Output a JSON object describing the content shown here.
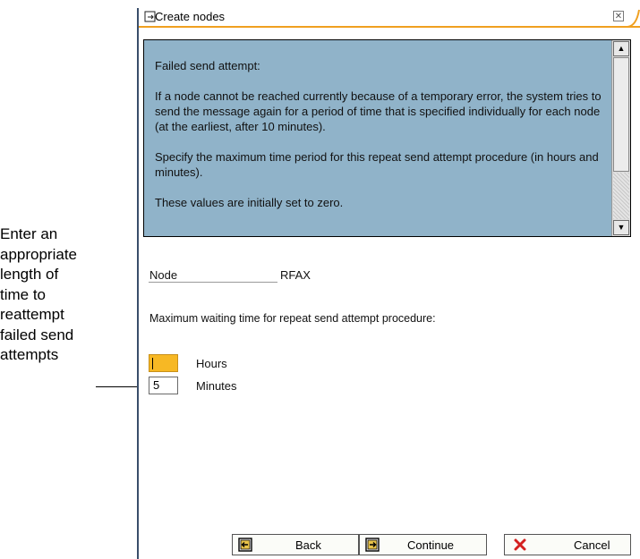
{
  "annotation": {
    "lines": [
      "Enter an",
      "appropriate",
      "length of",
      "time to",
      "reattempt",
      "failed send",
      "attempts"
    ]
  },
  "dialog": {
    "title": "Create nodes",
    "close_glyph": "✕",
    "help": {
      "paragraphs": [
        "Failed send attempt:",
        "If a node cannot be reached currently because of a temporary error, the system tries to send the message again for a period of time that is specified individually for each node (at the earliest, after 10 minutes).",
        "Specify the maximum time period for this repeat send attempt procedure (in hours and minutes).",
        "These values are initially set to zero."
      ]
    },
    "form": {
      "node_label": "Node",
      "node_value": "RFAX",
      "max_wait_label": "Maximum waiting time for repeat send attempt procedure:",
      "hours_value": "",
      "hours_label": "Hours",
      "minutes_value": "5",
      "minutes_label": "Minutes"
    },
    "buttons": {
      "back": "Back",
      "continue": "Continue",
      "cancel": "Cancel"
    }
  },
  "colors": {
    "help_bg": "#90b3c9",
    "active_field": "#f7b824",
    "title_accent": "#f0a020",
    "cancel_icon": "#d42020"
  }
}
